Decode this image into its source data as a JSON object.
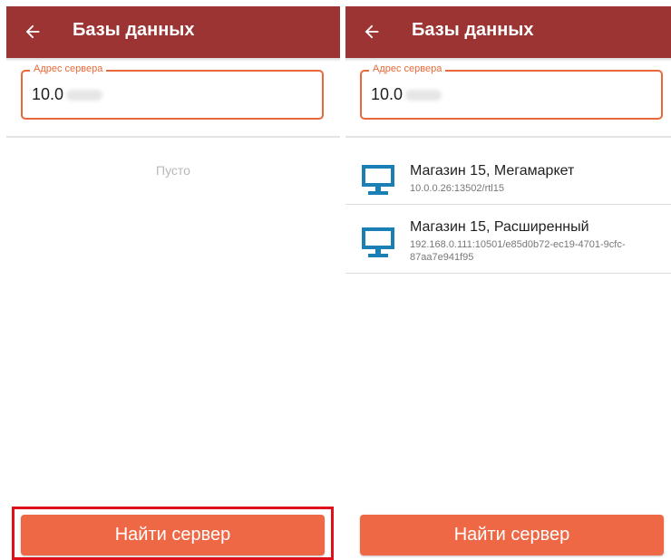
{
  "left_screen": {
    "title": "Базы данных",
    "back_icon": "arrow-back-icon",
    "server_field": {
      "label": "Адрес сервера",
      "value": "10.0"
    },
    "empty_text": "Пусто",
    "find_button": "Найти сервер"
  },
  "right_screen": {
    "title": "Базы данных",
    "back_icon": "arrow-back-icon",
    "server_field": {
      "label": "Адрес сервера",
      "value": "10.0"
    },
    "databases": [
      {
        "name": "Магазин 15, Мегамаркет",
        "address": "10.0.0.26:13502/rtl15",
        "icon": "monitor-icon"
      },
      {
        "name": "Магазин 15, Расширенный",
        "address": "192.168.0.111:10501/e85d0b72-ec19-4701-9cfc-87aa7e941f95",
        "icon": "monitor-icon"
      }
    ],
    "find_button": "Найти сервер"
  },
  "colors": {
    "appbar": "#9b3433",
    "accent": "#e8683b",
    "button": "#ef6845",
    "icon": "#1a7fb5",
    "highlight": "#e0101a"
  }
}
